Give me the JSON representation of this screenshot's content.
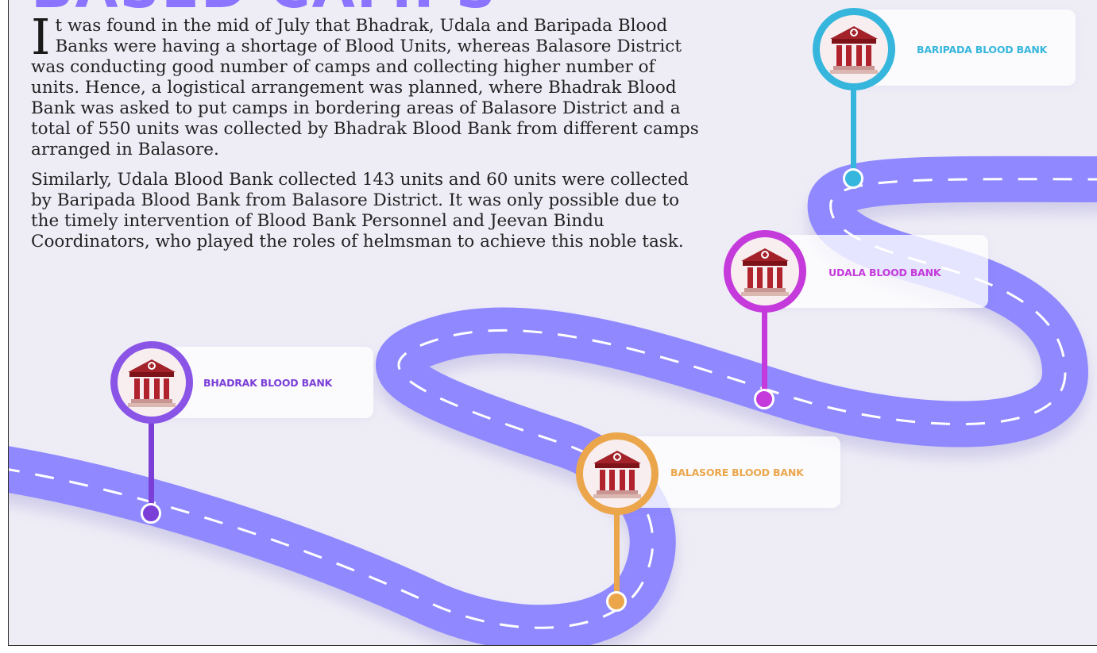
{
  "heading": "BASED CAMPS",
  "paragraphs": {
    "dropcap": "I",
    "first": "t was found in the mid of July that Bhadrak, Udala and Baripada Blood Banks were having a shortage of Blood Units, whereas Balasore District was conducting good number of camps and collecting higher number of units. Hence, a logistical arrangement was planned, where Bhadrak Blood Bank was asked to put camps in bordering areas of Balasore District and a total of 550 units was collected by Bhadrak Blood Bank from different camps arranged in Balasore.",
    "second": "Similarly, Udala Blood Bank collected 143 units and 60 units were collected by Baripada Blood Bank from Balasore District. It was only possible due to the timely intervention of Blood Bank Personnel and Jeevan Bindu Coordinators, who played the roles of helmsman to achieve this noble task."
  },
  "road": {
    "color": "#8f88ff"
  },
  "markers": {
    "baripada": {
      "label": "BARIPADA BLOOD BANK",
      "color": "#36b6dc",
      "icon": "bank-building-icon"
    },
    "udala": {
      "label": "UDALA BLOOD BANK",
      "color": "#c43adb",
      "icon": "bank-building-icon"
    },
    "bhadrak": {
      "label": "BHADRAK BLOOD BANK",
      "color": "#7b3fd8",
      "icon": "bank-building-icon"
    },
    "balasore": {
      "label": "BALASORE BLOOD BANK",
      "color": "#eba64c",
      "icon": "bank-building-icon"
    }
  }
}
